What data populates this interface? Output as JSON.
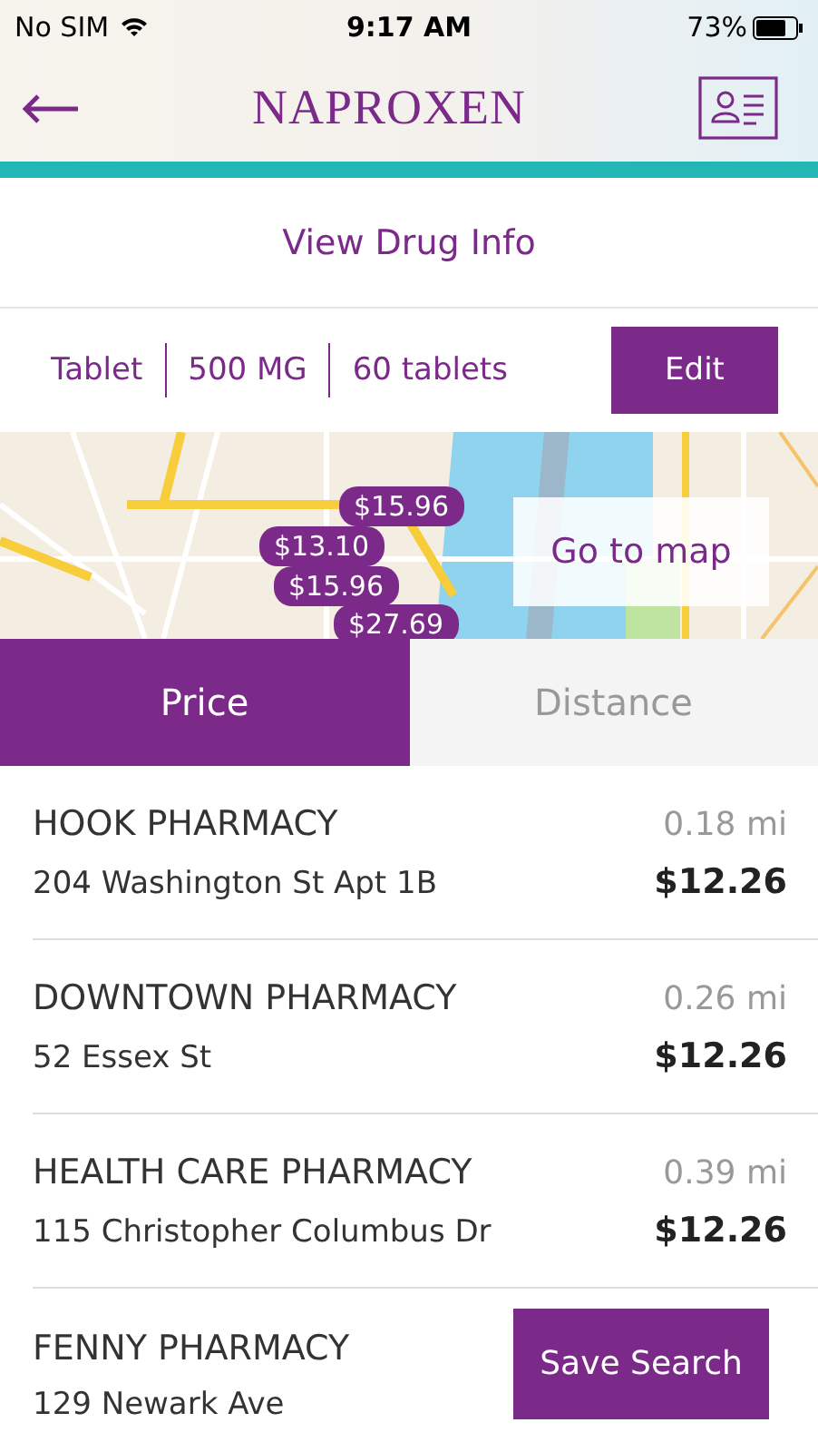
{
  "status_bar": {
    "carrier": "No SIM",
    "time": "9:17 AM",
    "battery": "73%"
  },
  "header": {
    "title": "NAPROXEN"
  },
  "drug_info_link": "View Drug Info",
  "options": [
    {
      "label": "Tablet"
    },
    {
      "label": "500 MG"
    },
    {
      "label": "60 tablets"
    }
  ],
  "edit_button": "Edit",
  "map": {
    "pins": [
      "$15.96",
      "$13.10",
      "$15.96",
      "$27.69"
    ],
    "go_to_map": "Go to map"
  },
  "sort_tabs": [
    {
      "label": "Price",
      "selected": true
    },
    {
      "label": "Distance",
      "selected": false
    }
  ],
  "pharmacies": [
    {
      "name": "HOOK PHARMACY",
      "address": "204 Washington St Apt 1B",
      "distance": "0.18 mi",
      "price": "$12.26"
    },
    {
      "name": "DOWNTOWN PHARMACY",
      "address": "52 Essex St",
      "distance": "0.26 mi",
      "price": "$12.26"
    },
    {
      "name": "HEALTH CARE PHARMACY",
      "address": "115 Christopher Columbus Dr",
      "distance": "0.39 mi",
      "price": "$12.26"
    },
    {
      "name": "FENNY PHARMACY",
      "address": "129 Newark Ave"
    }
  ],
  "save_button": "Save Search"
}
